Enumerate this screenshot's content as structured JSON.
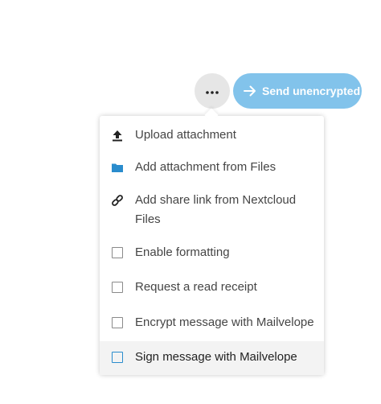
{
  "toolbar": {
    "more_icon": "ellipsis-icon",
    "send_label": "Send unencrypted",
    "send_icon": "arrow-right-icon",
    "send_color": "#82c3eb"
  },
  "menu": {
    "items": [
      {
        "label": "Upload attachment",
        "icon": "upload-icon"
      },
      {
        "label": "Add attachment from Files",
        "icon": "folder-icon"
      },
      {
        "label": "Add share link from Nextcloud Files",
        "icon": "link-icon"
      },
      {
        "label": "Enable formatting",
        "checked": false
      },
      {
        "label": "Request a read receipt",
        "checked": false
      },
      {
        "label": "Encrypt message with Mailvelope",
        "checked": false
      },
      {
        "label": "Sign message with Mailvelope",
        "checked": false
      }
    ]
  },
  "accent_color": "#2a8ccd"
}
